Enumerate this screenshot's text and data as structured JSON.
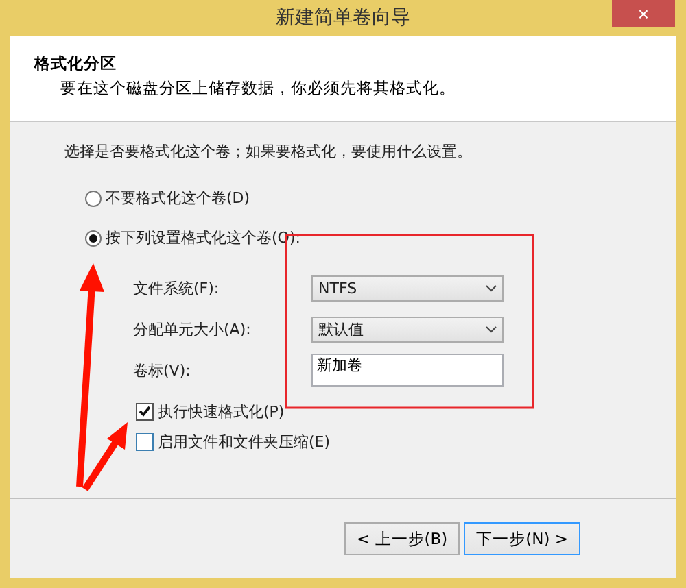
{
  "window": {
    "title": "新建简单卷向导",
    "close": "×"
  },
  "header": {
    "title": "格式化分区",
    "subtitle": "要在这个磁盘分区上储存数据，你必须先将其格式化。"
  },
  "prompt": "选择是否要格式化这个卷；如果要格式化，要使用什么设置。",
  "options": [
    {
      "label": "不要格式化这个卷(D)",
      "selected": false
    },
    {
      "label": "按下列设置格式化这个卷(O):",
      "selected": true
    }
  ],
  "fields": [
    {
      "kind": "select",
      "label": "文件系统(F):",
      "value": "NTFS"
    },
    {
      "kind": "select",
      "label": "分配单元大小(A):",
      "value": "默认值"
    },
    {
      "kind": "text",
      "label": "卷标(V):",
      "value": "新加卷"
    }
  ],
  "checkboxes": [
    {
      "label": "执行快速格式化(P)",
      "checked": true
    },
    {
      "label": "启用文件和文件夹压缩(E)",
      "checked": false
    }
  ],
  "buttons": [
    {
      "label": "< 上一步(B)",
      "selected": false
    },
    {
      "label": "下一步(N) >",
      "selected": true
    }
  ]
}
